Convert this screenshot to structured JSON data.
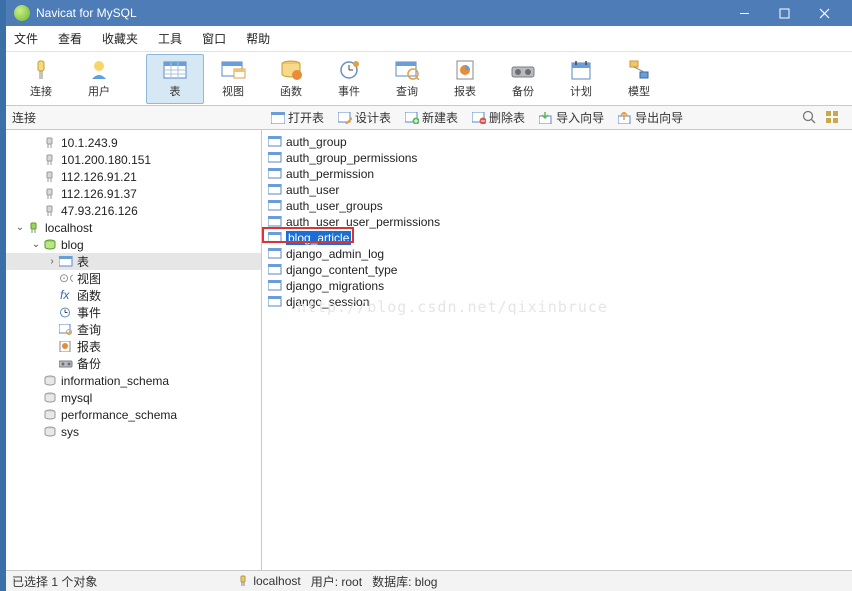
{
  "window": {
    "title": "Navicat for MySQL"
  },
  "menu": {
    "file": "文件",
    "view": "查看",
    "fav": "收藏夹",
    "tools": "工具",
    "window": "窗口",
    "help": "帮助"
  },
  "toolbar": {
    "connect": "连接",
    "user": "用户",
    "table": "表",
    "view": "视图",
    "function": "函数",
    "event": "事件",
    "query": "查询",
    "report": "报表",
    "backup": "备份",
    "plan": "计划",
    "model": "模型"
  },
  "subtoolbar": {
    "left": "连接",
    "open": "打开表",
    "design": "设计表",
    "new": "新建表",
    "delete": "删除表",
    "import": "导入向导",
    "export": "导出向导"
  },
  "sidebar": {
    "connections": [
      "10.1.243.9",
      "101.200.180.151",
      "112.126.91.21",
      "112.126.91.37",
      "47.93.216.126"
    ],
    "localhost": "localhost",
    "blog": "blog",
    "blog_children": {
      "table": "表",
      "view": "视图",
      "func": "函数",
      "event": "事件",
      "query": "查询",
      "report": "报表",
      "backup": "备份"
    },
    "dbs": [
      "information_schema",
      "mysql",
      "performance_schema",
      "sys"
    ]
  },
  "tables": [
    "auth_group",
    "auth_group_permissions",
    "auth_permission",
    "auth_user",
    "auth_user_groups",
    "auth_user_user_permissions",
    "blog_article",
    "django_admin_log",
    "django_content_type",
    "django_migrations",
    "django_session"
  ],
  "selected_table_index": 6,
  "watermark": "http://blog.csdn.net/qixinbruce",
  "statusbar": {
    "sel": "已选择 1 个对象",
    "host": "localhost",
    "user": "用户: root",
    "db": "数据库: blog"
  }
}
